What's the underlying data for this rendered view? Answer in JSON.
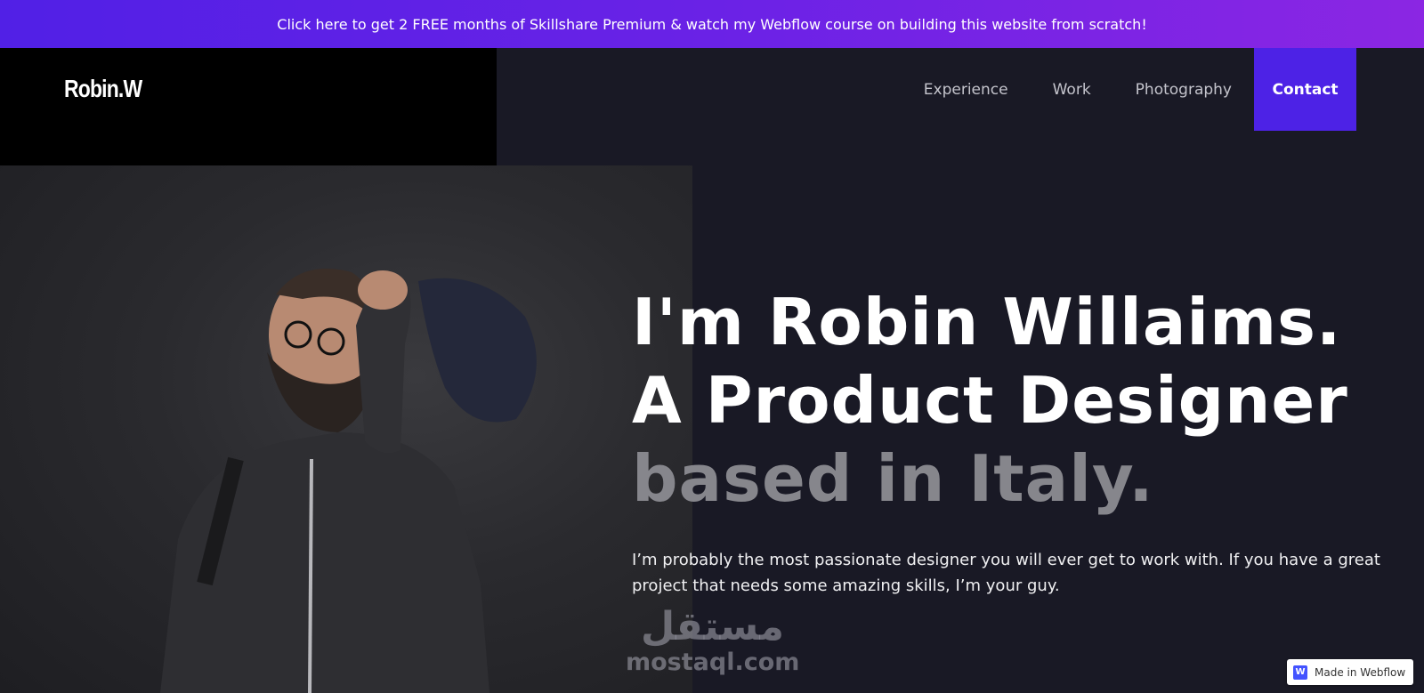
{
  "promo": {
    "text": "Click here to get 2 FREE months of Skillshare Premium & watch my Webflow course on building this website from scratch!"
  },
  "header": {
    "logo": "Robin.W",
    "nav": [
      {
        "label": "Experience"
      },
      {
        "label": "Work"
      },
      {
        "label": "Photography"
      },
      {
        "label": "Contact"
      }
    ]
  },
  "hero": {
    "line1": "I'm Robin Willaims.",
    "line2": "A Product Designer",
    "line3": "based in Italy.",
    "intro": "I’m probably the most passionate designer you will ever get to work with. If you have a great project that needs some amazing skills, I’m your guy."
  },
  "watermark": {
    "arabic": "مستقل",
    "latin": "mostaql.com"
  },
  "badge": {
    "icon_letter": "W",
    "label": "Made in Webflow"
  },
  "colors": {
    "accent": "#4d22e6",
    "background": "#191925",
    "banner_start": "#5120e6",
    "banner_end": "#8b26e3"
  }
}
